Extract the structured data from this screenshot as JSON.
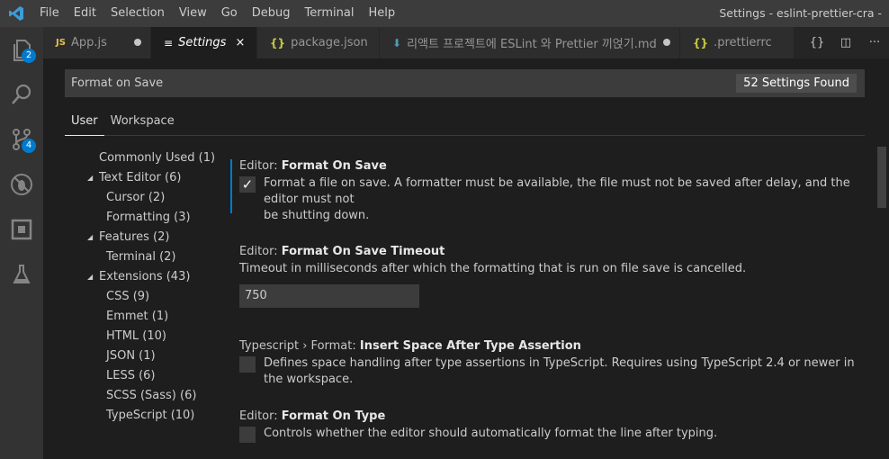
{
  "menu": [
    "File",
    "Edit",
    "Selection",
    "View",
    "Go",
    "Debug",
    "Terminal",
    "Help"
  ],
  "window_title": "Settings - eslint-prettier-cra -",
  "activity": {
    "explorer_badge": "2",
    "scm_badge": "4"
  },
  "tabs": [
    {
      "icon": "JS",
      "label": "App.js"
    },
    {
      "icon": "≡",
      "label": "Settings",
      "close": "×"
    },
    {
      "icon": "{}",
      "label": "package.json"
    },
    {
      "icon": "⬇",
      "label": "리액트 프로젝트에 ESLint 와 Prettier 끼얹기.md"
    },
    {
      "icon": "{}",
      "label": ".prettierrc"
    }
  ],
  "tab_actions": [
    "{}",
    "◫",
    "···"
  ],
  "search": {
    "value": "Format on Save",
    "count": "52 Settings Found"
  },
  "scopes": [
    "User",
    "Workspace"
  ],
  "toc": [
    {
      "label": "Commonly Used (1)"
    },
    {
      "label": "Text Editor (6)"
    },
    {
      "label": "Cursor (2)"
    },
    {
      "label": "Formatting (3)"
    },
    {
      "label": "Features (2)"
    },
    {
      "label": "Terminal (2)"
    },
    {
      "label": "Extensions (43)"
    },
    {
      "label": "CSS (9)"
    },
    {
      "label": "Emmet (1)"
    },
    {
      "label": "HTML (10)"
    },
    {
      "label": "JSON (1)"
    },
    {
      "label": "LESS (6)"
    },
    {
      "label": "SCSS (Sass) (6)"
    },
    {
      "label": "TypeScript (10)"
    }
  ],
  "settings": [
    {
      "category": "Editor: ",
      "name": "Format On Save",
      "check": "✓",
      "desc1": "Format a file on save. A formatter must be available, the file must not be saved after delay, and the editor must not",
      "desc2": "be shutting down."
    },
    {
      "category": "Editor: ",
      "name": "Format On Save Timeout",
      "desc": "Timeout in milliseconds after which the formatting that is run on file save is cancelled.",
      "value": "750"
    },
    {
      "category": "Typescript › Format: ",
      "name": "Insert Space After Type Assertion",
      "desc": "Defines space handling after type assertions in TypeScript. Requires using TypeScript 2.4 or newer in the workspace."
    },
    {
      "category": "Editor: ",
      "name": "Format On Type",
      "desc": "Controls whether the editor should automatically format the line after typing."
    }
  ],
  "colors": {
    "accent": "#007acc",
    "js_icon": "#e8c14b",
    "json_icon": "#cbcb41",
    "md_icon": "#519aba"
  }
}
